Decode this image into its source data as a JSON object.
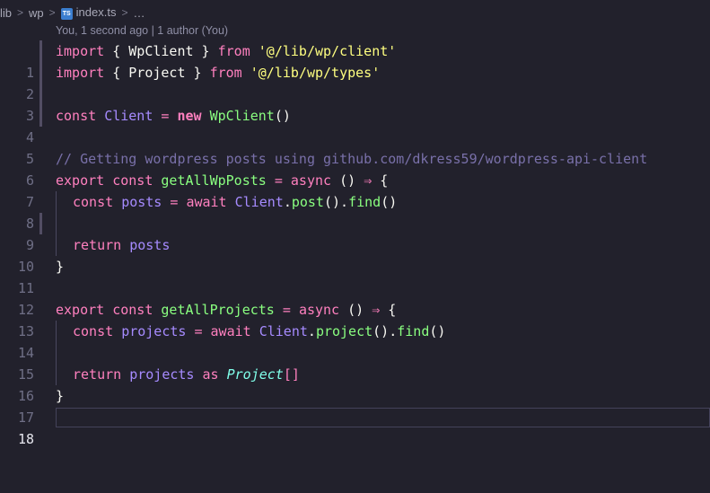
{
  "breadcrumb": {
    "segments": [
      "lib",
      "wp",
      "index.ts",
      "…"
    ],
    "file_icon": "TS",
    "separator": ">"
  },
  "codelens": "You, 1 second ago | 1 author (You)",
  "editor": {
    "active_line": 18,
    "lines": [
      {
        "n": "1"
      },
      {
        "n": "2"
      },
      {
        "n": "3"
      },
      {
        "n": "4"
      },
      {
        "n": "5"
      },
      {
        "n": "6"
      },
      {
        "n": "7"
      },
      {
        "n": "8"
      },
      {
        "n": "9"
      },
      {
        "n": "10"
      },
      {
        "n": "11"
      },
      {
        "n": "12"
      },
      {
        "n": "13"
      },
      {
        "n": "14"
      },
      {
        "n": "15"
      },
      {
        "n": "16"
      },
      {
        "n": "17"
      },
      {
        "n": "18"
      }
    ],
    "tokens": {
      "import": "import",
      "from": "from",
      "lbrace": "{ ",
      "rbrace": " }",
      "wpclient": "WpClient",
      "project_type": "Project",
      "str_client": "'@/lib/wp/client'",
      "str_types": "'@/lib/wp/types'",
      "const": "const",
      "client": "Client",
      "eq": "=",
      "new": "new",
      "call": "()",
      "comment": "// Getting wordpress posts using github.com/dkress59/wordpress-api-client",
      "export": "export",
      "getAllWpPosts": "getAllWpPosts",
      "getAllProjects": "getAllProjects",
      "async": "async",
      "arrow": "⇒",
      "lbrace_end": "{",
      "rbrace_line": "}",
      "posts": "posts",
      "projects": "projects",
      "await": "await",
      "dot": ".",
      "post": "post",
      "project": "project",
      "find": "find",
      "return": "return",
      "as": "as",
      "arr": "[]"
    }
  }
}
